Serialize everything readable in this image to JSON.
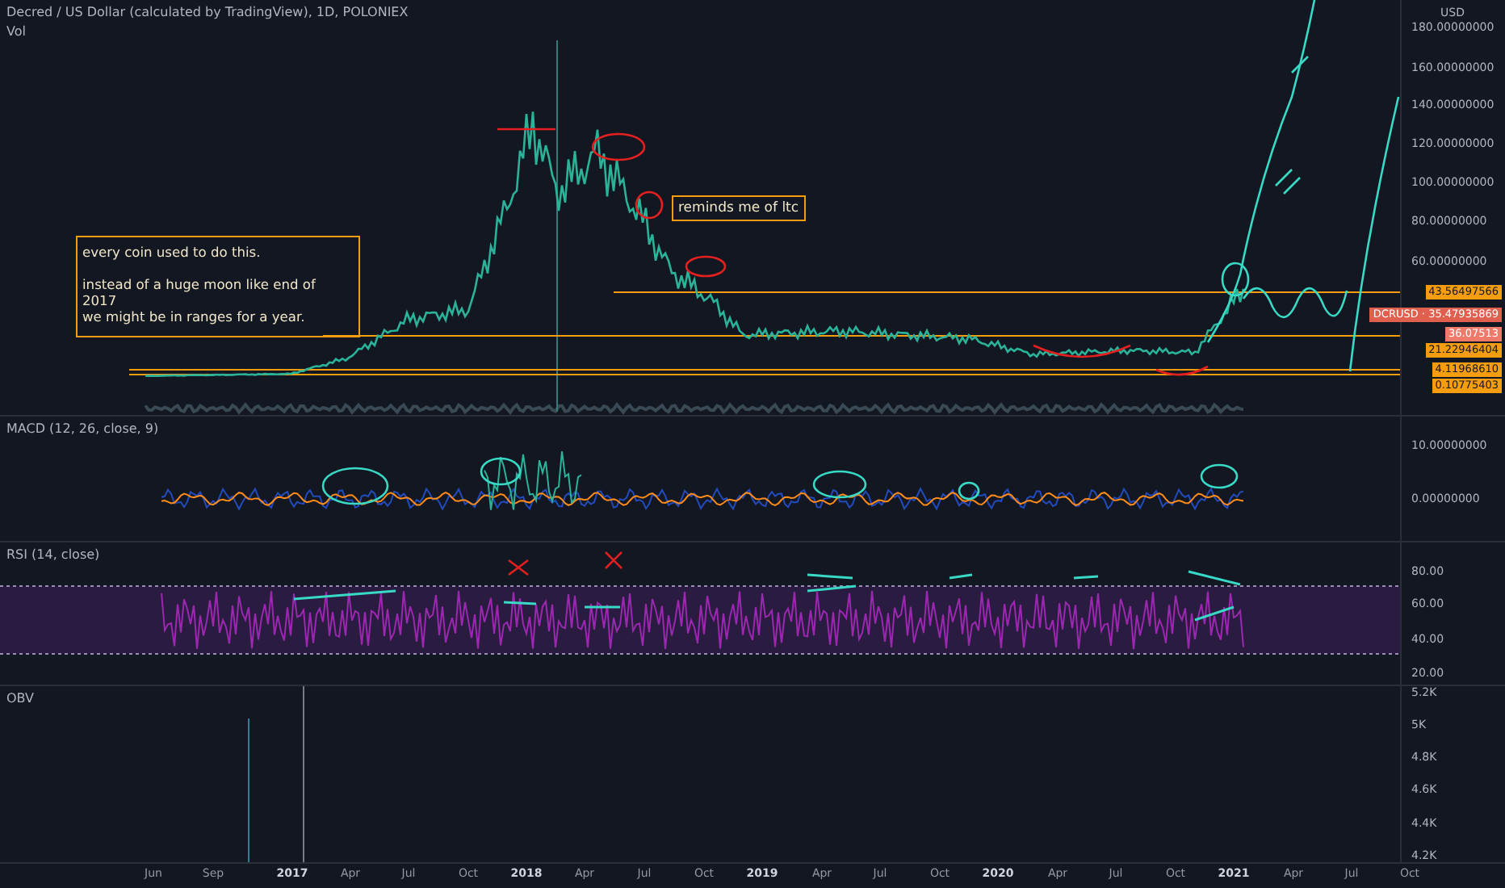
{
  "symbol": {
    "title": "Decred / US Dollar (calculated by TradingView), 1D, POLONIEX",
    "volume_label": "Vol"
  },
  "main_pane": {
    "currency": "USD",
    "ticks": [
      "180.00000000",
      "160.00000000",
      "140.00000000",
      "120.00000000",
      "100.00000000",
      "80.00000000",
      "60.00000000"
    ],
    "price_labels": [
      {
        "text": "43.56497566",
        "kind": "level"
      },
      {
        "text": "DCRUSD · 35.47935869",
        "kind": "symbol"
      },
      {
        "text": "36.07513",
        "kind": "price"
      },
      {
        "text": "21.22946404",
        "kind": "level"
      },
      {
        "text": "4.11968610",
        "kind": "level"
      },
      {
        "text": "0.10775403",
        "kind": "level"
      }
    ],
    "notes": [
      {
        "text": "every coin used to do this.\n\ninstead of a huge moon like end of 2017\nwe might be in ranges for a year."
      },
      {
        "text": "reminds me of ltc"
      }
    ]
  },
  "panes": [
    {
      "kind": "macd",
      "label": "MACD (12, 26, close, 9)",
      "ticks": [
        "10.00000000",
        "0.00000000"
      ]
    },
    {
      "kind": "rsi",
      "label": "RSI (14, close)",
      "ticks": [
        "80.00",
        "60.00",
        "40.00",
        "20.00"
      ]
    },
    {
      "kind": "obv",
      "label": "OBV",
      "ticks": [
        "5.2K",
        "5K",
        "4.8K",
        "4.6K",
        "4.4K",
        "4.2K"
      ]
    }
  ],
  "time_axis": [
    {
      "label": "Jun",
      "year": false
    },
    {
      "label": "Sep",
      "year": false
    },
    {
      "label": "2017",
      "year": true
    },
    {
      "label": "Apr",
      "year": false
    },
    {
      "label": "Jul",
      "year": false
    },
    {
      "label": "Oct",
      "year": false
    },
    {
      "label": "2018",
      "year": true
    },
    {
      "label": "Apr",
      "year": false
    },
    {
      "label": "Jul",
      "year": false
    },
    {
      "label": "Oct",
      "year": false
    },
    {
      "label": "2019",
      "year": true
    },
    {
      "label": "Apr",
      "year": false
    },
    {
      "label": "Jul",
      "year": false
    },
    {
      "label": "Oct",
      "year": false
    },
    {
      "label": "2020",
      "year": true
    },
    {
      "label": "Apr",
      "year": false
    },
    {
      "label": "Jul",
      "year": false
    },
    {
      "label": "Oct",
      "year": false
    },
    {
      "label": "2021",
      "year": true
    },
    {
      "label": "Apr",
      "year": false
    },
    {
      "label": "Jul",
      "year": false
    },
    {
      "label": "Oct",
      "year": false
    }
  ]
}
